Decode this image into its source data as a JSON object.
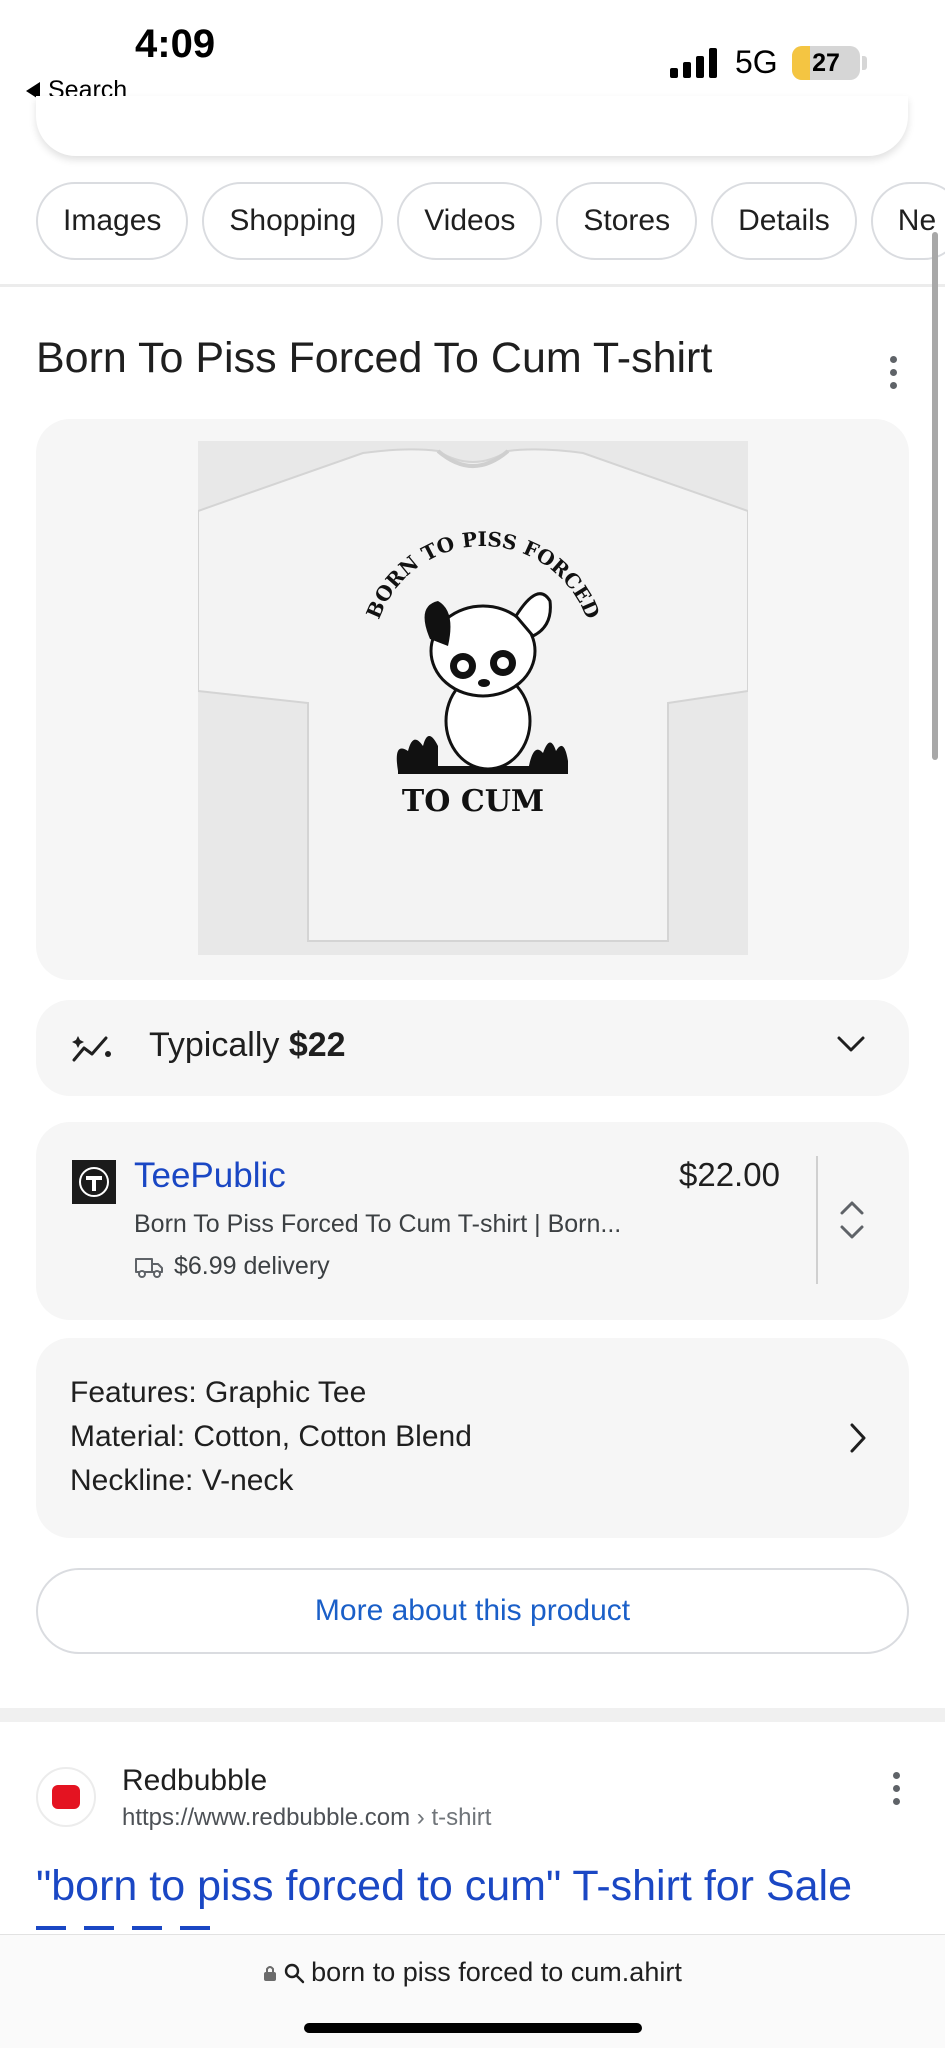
{
  "status_bar": {
    "time": "4:09",
    "back_label": "Search",
    "network": "5G",
    "battery": "27",
    "battery_level": 0.27
  },
  "chips": [
    "Images",
    "Shopping",
    "Videos",
    "Stores",
    "Details",
    "Ne"
  ],
  "product": {
    "title": "Born To Piss Forced To Cum T-shirt",
    "image_print": {
      "arc_text": "BORN TO PISS FORCED",
      "bottom_text": "TO CUM"
    },
    "typical_label": "Typically",
    "typical_price": "$22"
  },
  "seller": {
    "name": "TeePublic",
    "price": "$22.00",
    "description": "Born To Piss Forced To Cum T-shirt | Born...",
    "delivery": "$6.99 delivery"
  },
  "features": {
    "lines": [
      "Features: Graphic Tee",
      "Material: Cotton, Cotton Blend",
      "Neckline: V-neck"
    ]
  },
  "more_button": "More about this product",
  "result": {
    "site": "Redbubble",
    "url": "https://www.redbubble.com",
    "path": " › t-shirt",
    "title": "\"born to piss forced to cum\" T-shirt for Sale"
  },
  "bottom_bar": {
    "address": "born to piss forced to cum.ahirt"
  },
  "colors": {
    "link_blue": "#1a47c4",
    "button_blue": "#1a5fc8",
    "card_bg": "#f6f6f6",
    "battery_yellow": "#f4c542",
    "redbubble_red": "#e41321"
  }
}
